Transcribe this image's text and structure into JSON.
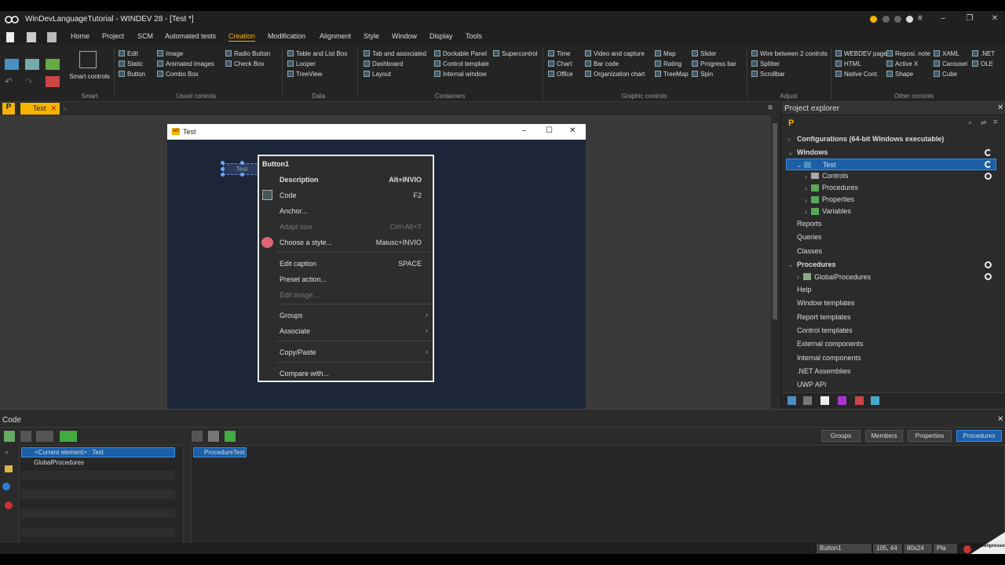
{
  "app": {
    "title": "WinDevLanguageTutorial - WINDEV 28 - [Test *]"
  },
  "menu": [
    "Home",
    "Project",
    "SCM",
    "Automated tests",
    "Creation",
    "Modification",
    "Alignment",
    "Style",
    "Window",
    "Display",
    "Tools"
  ],
  "ribbon": {
    "smart_controls": "Smart controls",
    "usual": {
      "col1": [
        "Edit",
        "Static",
        "Button"
      ],
      "col2": [
        "Image",
        "Animated images",
        "Combo Box"
      ],
      "col3": [
        "Radio Button",
        "Check Box"
      ]
    },
    "data": [
      "Table and List Box",
      "Looper",
      "TreeView"
    ],
    "containers": {
      "col1": [
        "Tab and associated",
        "Dashboard",
        "Layout"
      ],
      "col2": [
        "Dockable Panel",
        "Control template",
        "Internal window"
      ],
      "col3": [
        "Supercontrol"
      ]
    },
    "graphic": {
      "col1": [
        "Time",
        "Chart",
        "Office"
      ],
      "col2": [
        "Video and capture",
        "Bar code",
        "Organization chart"
      ],
      "col3": [
        "Map",
        "Rating",
        "TreeMap"
      ],
      "col4": [
        "Slider",
        "Progress bar",
        "Spin"
      ]
    },
    "adjust": [
      "Wire between 2 controls",
      "Splitter",
      "Scrollbar"
    ],
    "other": {
      "col1": [
        "WEBDEV page",
        "HTML",
        "Native Cont."
      ],
      "col2": [
        "Reposi. note",
        "Active X",
        "Shape"
      ],
      "col3": [
        "XAML",
        "Carousel",
        "Cube"
      ],
      "col4": [
        ".NET",
        "OLE"
      ]
    },
    "groups": [
      "Smart",
      "Usual controls",
      "Data",
      "Containers",
      "Graphic controls",
      "Adjust",
      "Other controls"
    ]
  },
  "tab": {
    "label": "Test"
  },
  "window": {
    "title": "Test",
    "button_caption": "Test"
  },
  "context_menu": {
    "header": "Button1",
    "items": [
      {
        "label": "Description",
        "shortcut": "Alt+INVIO"
      },
      {
        "label": "Code",
        "shortcut": "F2"
      },
      {
        "label": "Anchor..."
      },
      {
        "label": "Adapt size",
        "shortcut": "Ctrl+Alt+T"
      },
      {
        "label": "Choose a style...",
        "shortcut": "Maiusc+INVIO"
      },
      {
        "label": "Edit caption",
        "shortcut": "SPACE"
      },
      {
        "label": "Preset action..."
      },
      {
        "label": "Edit image..."
      },
      {
        "label": "Groups"
      },
      {
        "label": "Associate"
      },
      {
        "label": "Copy/Paste"
      },
      {
        "label": "Compare with..."
      }
    ]
  },
  "explorer": {
    "title": "Project explorer",
    "items": [
      "Configurations (64-bit Windows executable)",
      "Windows",
      "Test",
      "Controls",
      "Procedures",
      "Properties",
      "Variables",
      "Reports",
      "Queries",
      "Classes",
      "Procedures",
      "GlobalProcedures",
      "Help",
      "Window templates",
      "Report templates",
      "Control templates",
      "External components",
      "Internal components",
      ".NET Assemblies",
      "UWP API"
    ]
  },
  "code": {
    "title": "Code",
    "elements": [
      "<Current element> : Test",
      "GlobalProcedures"
    ],
    "procedure": "ProcedureTest",
    "buttons": [
      "Groups",
      "Members",
      "Properties",
      "Procedures"
    ]
  },
  "status": {
    "control": "Button1",
    "pos": "105, 44",
    "size": "80x24",
    "plan": "Pla"
  },
  "watermark": "Screenpresso"
}
